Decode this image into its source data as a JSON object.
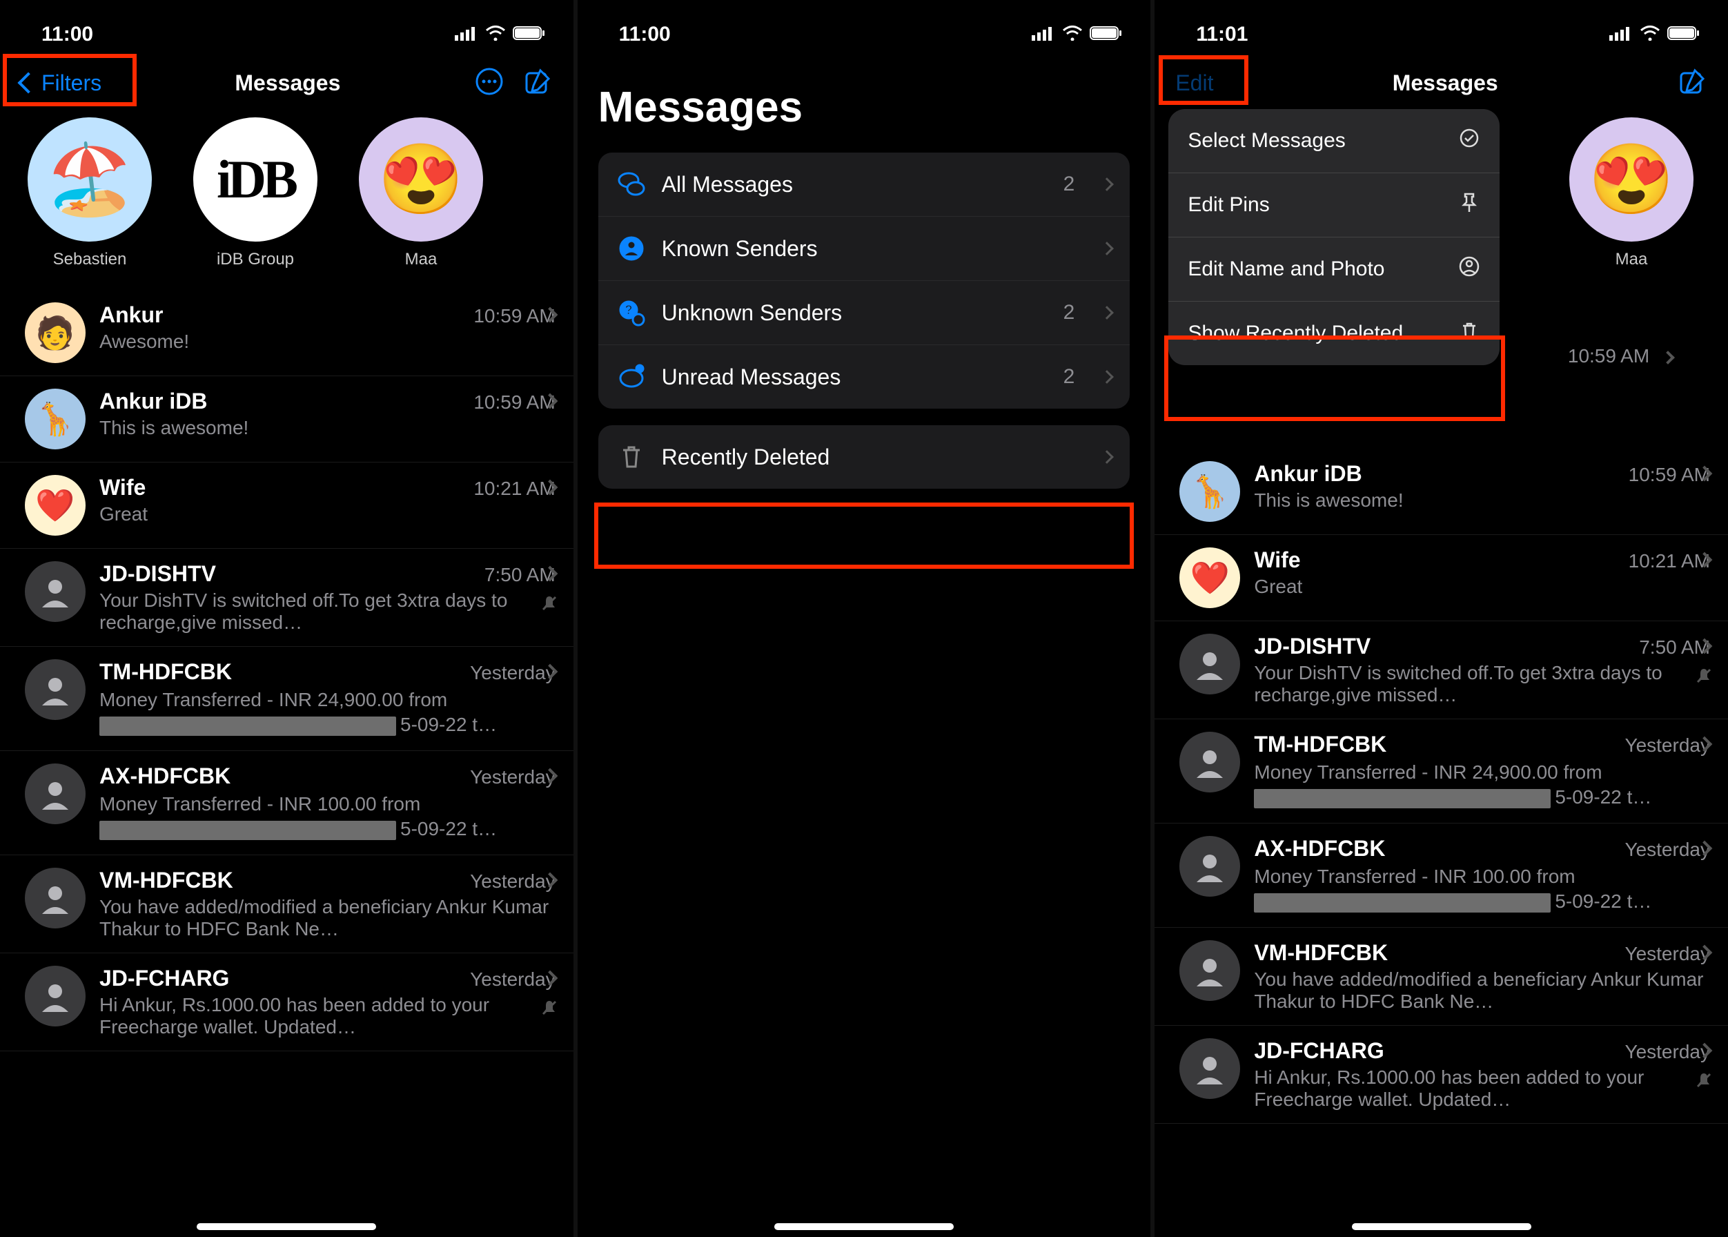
{
  "phone1": {
    "time": "11:00",
    "nav_back": "Filters",
    "nav_title": "Messages",
    "pins": [
      {
        "label": "Sebastien",
        "visual": "island",
        "bg": "skyblue"
      },
      {
        "label": "iDB Group",
        "visual": "idb",
        "bg": "white"
      },
      {
        "label": "Maa",
        "visual": "heart-eyes",
        "bg": "purple"
      }
    ],
    "conversations": [
      {
        "name": "Ankur",
        "time": "10:59 AM",
        "preview": "Awesome!",
        "avatar": "photo"
      },
      {
        "name": "Ankur iDB",
        "time": "10:59 AM",
        "preview": "This is awesome!",
        "avatar": "giraffe"
      },
      {
        "name": "Wife",
        "time": "10:21 AM",
        "preview": "Great",
        "avatar": "emoji",
        "emoji": "❤️"
      },
      {
        "name": "JD-DISHTV",
        "time": "7:50 AM",
        "preview": "Your DishTV is switched off.To get 3xtra days to recharge,give missed…",
        "avatar": "placeholder",
        "muted": true
      },
      {
        "name": "TM-HDFCBK",
        "time": "Yesterday",
        "preview_pre": "Money Transferred - INR 24,900.00 from",
        "preview_post": "5-09-22 t…",
        "redacted": true,
        "avatar": "placeholder"
      },
      {
        "name": "AX-HDFCBK",
        "time": "Yesterday",
        "preview_pre": "Money Transferred - INR 100.00 from",
        "preview_post": "5-09-22 t…",
        "redacted": true,
        "avatar": "placeholder"
      },
      {
        "name": "VM-HDFCBK",
        "time": "Yesterday",
        "preview": "You have added/modified a beneficiary Ankur Kumar Thakur to HDFC Bank Ne…",
        "avatar": "placeholder"
      },
      {
        "name": "JD-FCHARG",
        "time": "Yesterday",
        "preview": "Hi Ankur, Rs.1000.00 has been added to your Freecharge wallet. Updated…",
        "avatar": "placeholder",
        "muted": true
      }
    ]
  },
  "phone2": {
    "time": "11:00",
    "title": "Messages",
    "filters": [
      {
        "label": "All Messages",
        "icon": "bubbles",
        "count": "2"
      },
      {
        "label": "Known Senders",
        "icon": "known",
        "count": ""
      },
      {
        "label": "Unknown Senders",
        "icon": "unknown",
        "count": "2"
      },
      {
        "label": "Unread Messages",
        "icon": "unread",
        "count": "2"
      }
    ],
    "deleted_label": "Recently Deleted"
  },
  "phone3": {
    "time": "11:01",
    "edit_label": "Edit",
    "nav_title": "Messages",
    "pin_label": "Maa",
    "menu": [
      {
        "label": "Select Messages",
        "icon": "check-circle"
      },
      {
        "label": "Edit Pins",
        "icon": "pin"
      },
      {
        "label": "Edit Name and Photo",
        "icon": "person-circle"
      },
      {
        "label": "Show Recently Deleted",
        "icon": "trash"
      }
    ],
    "conversations": [
      {
        "name": "Ankur iDB",
        "time": "10:59 AM",
        "preview": "This is awesome!",
        "avatar": "giraffe"
      },
      {
        "name": "Wife",
        "time": "10:21 AM",
        "preview": "Great",
        "avatar": "emoji",
        "emoji": "❤️"
      },
      {
        "name": "JD-DISHTV",
        "time": "7:50 AM",
        "preview": "Your DishTV is switched off.To get 3xtra days to recharge,give missed…",
        "avatar": "placeholder",
        "muted": true
      },
      {
        "name": "TM-HDFCBK",
        "time": "Yesterday",
        "preview_pre": "Money Transferred - INR 24,900.00 from",
        "preview_post": "5-09-22 t…",
        "redacted": true,
        "avatar": "placeholder"
      },
      {
        "name": "AX-HDFCBK",
        "time": "Yesterday",
        "preview_pre": "Money Transferred - INR 100.00 from",
        "preview_post": "5-09-22 t…",
        "redacted": true,
        "avatar": "placeholder"
      },
      {
        "name": "VM-HDFCBK",
        "time": "Yesterday",
        "preview": "You have added/modified a beneficiary Ankur Kumar Thakur to HDFC Bank Ne…",
        "avatar": "placeholder"
      },
      {
        "name": "JD-FCHARG",
        "time": "Yesterday",
        "preview": "Hi Ankur, Rs.1000.00 has been added to your Freecharge wallet. Updated…",
        "avatar": "placeholder",
        "muted": true
      }
    ],
    "visible_time_10_59": "10:59 AM"
  }
}
